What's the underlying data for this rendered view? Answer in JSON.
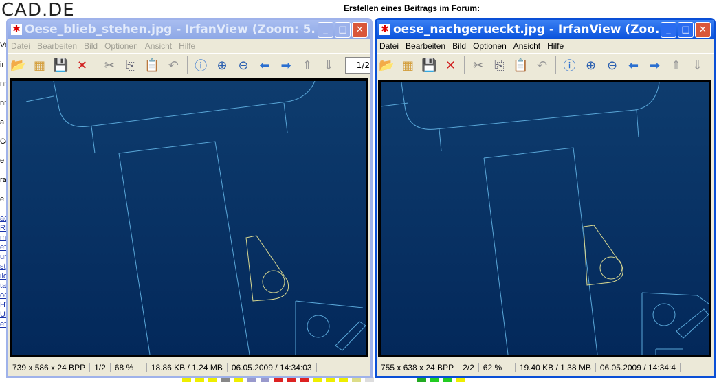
{
  "page": {
    "logo": "CAD.DE",
    "heading": "Erstellen eines Beitrags im Forum:",
    "bg_fragments": [
      "Ve",
      "ir",
      "nn",
      "nn",
      "a",
      "Co",
      "e",
      "ra",
      "e",
      "ac",
      "RL",
      "m",
      "ett",
      "ur",
      "st",
      "ilo",
      "ta",
      "oc",
      "HT",
      "UB",
      "et"
    ]
  },
  "windows": [
    {
      "title": "Oese_blieb_stehen.jpg - IrfanView (Zoom: 5...",
      "state": "inactive",
      "menu": [
        "Datei",
        "Bearbeiten",
        "Bild",
        "Optionen",
        "Ansicht",
        "Hilfe"
      ],
      "page_box": "1/2",
      "status": [
        "739 x 586 x 24 BPP",
        "1/2",
        "68 %",
        "18.86 KB / 1.24 MB",
        "06.05.2009 / 14:34:03"
      ]
    },
    {
      "title": "oese_nachgerueckt.jpg - IrfanView (Zoo...",
      "state": "active",
      "menu": [
        "Datei",
        "Bearbeiten",
        "Bild",
        "Optionen",
        "Ansicht",
        "Hilfe"
      ],
      "status": [
        "755 x 638 x 24 BPP",
        "2/2",
        "62 %",
        "19.40 KB / 1.38 MB",
        "06.05.2009 / 14:34:4"
      ]
    }
  ],
  "colors": {
    "canvas_top": "#0e3c6e",
    "canvas_bottom": "#03285a",
    "line": "#5aa7d8",
    "outline_yellow": "#d8d890"
  }
}
